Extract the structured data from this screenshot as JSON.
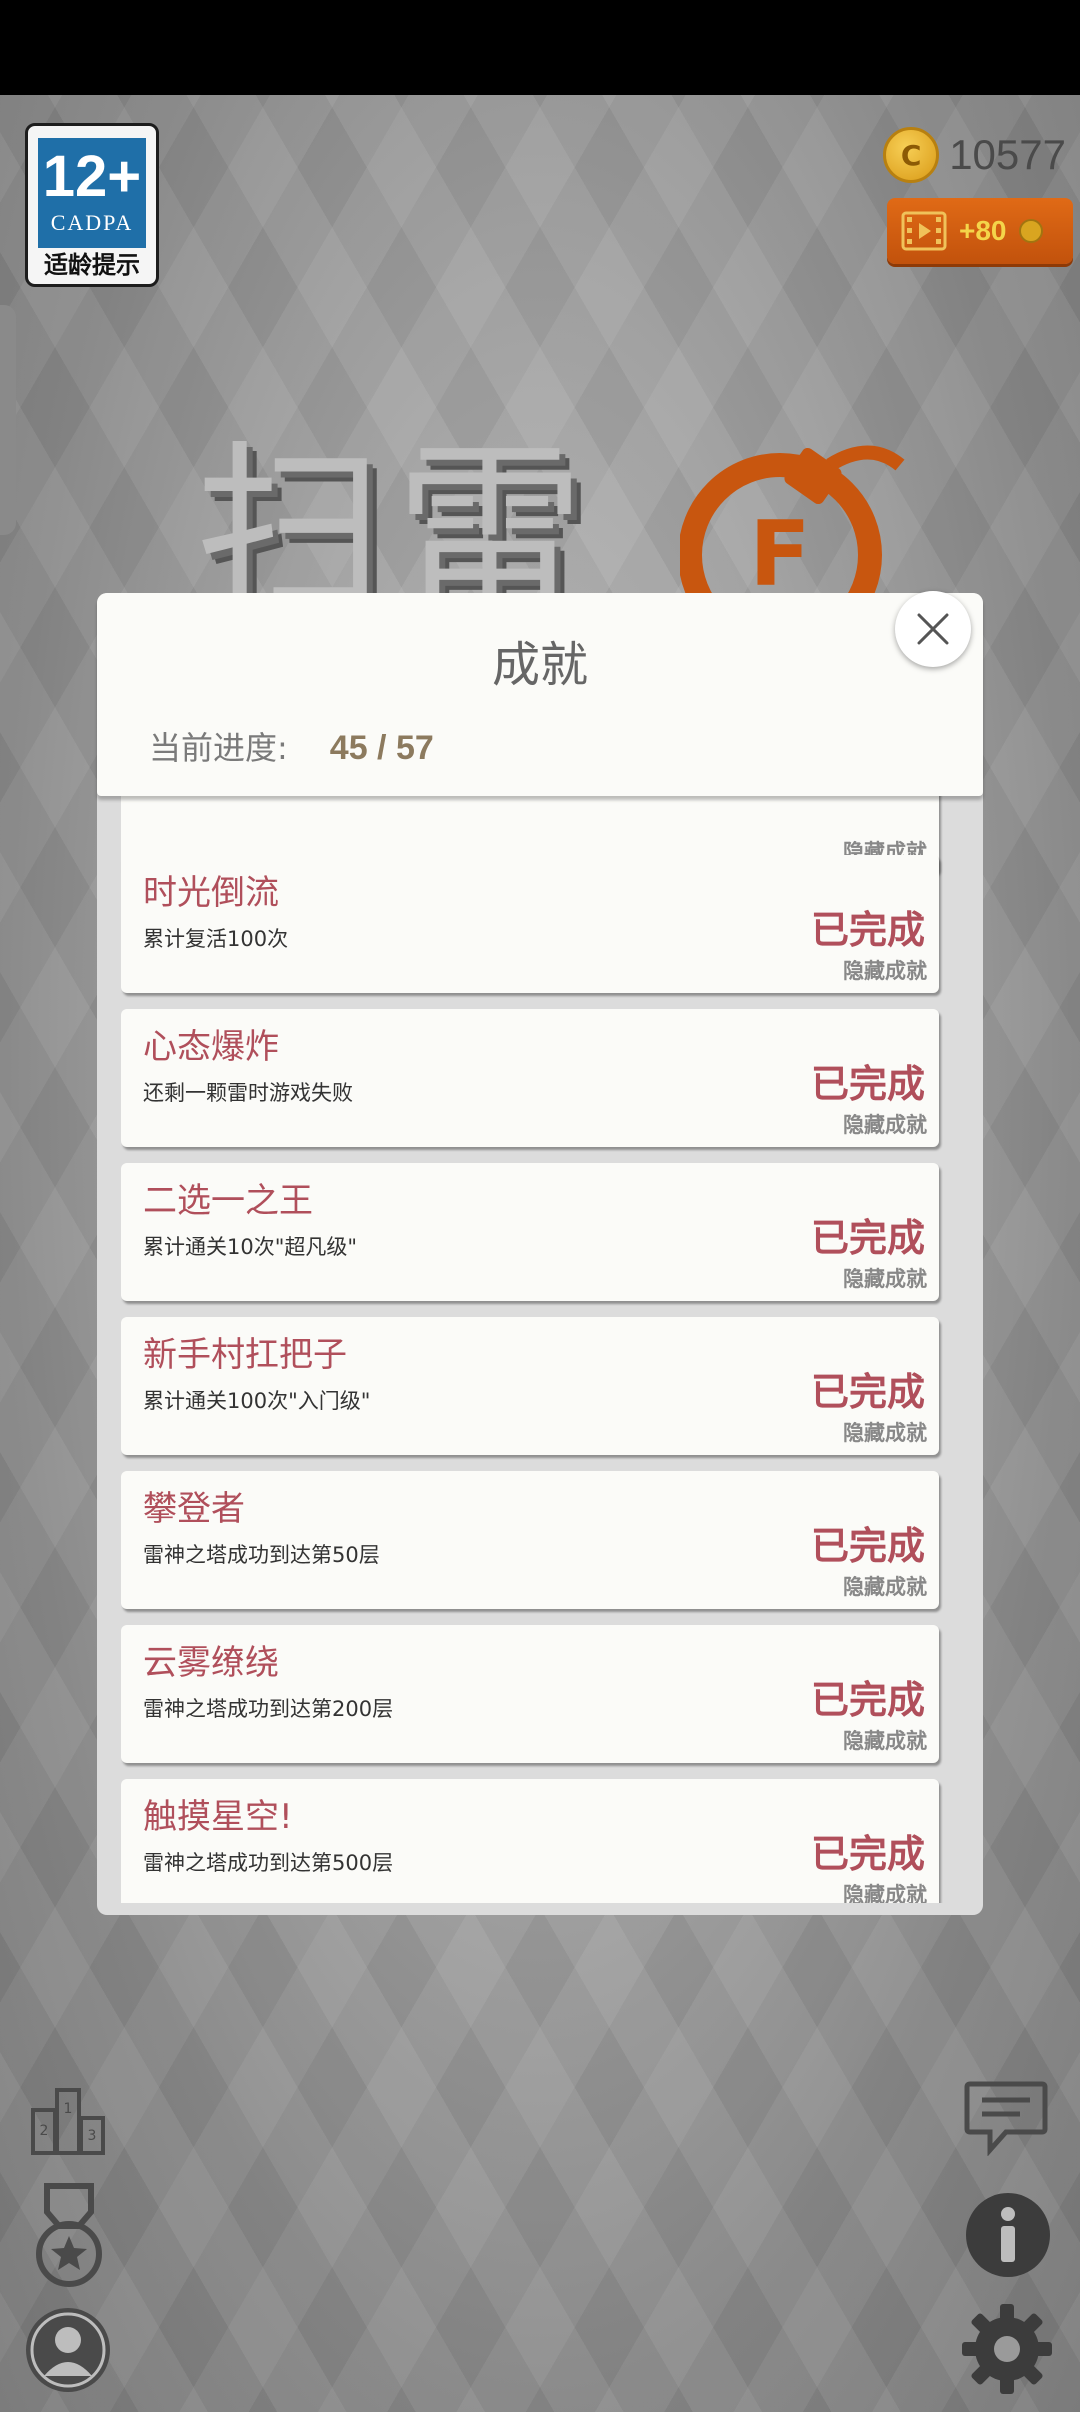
{
  "hud": {
    "age_rating": {
      "number": "12+",
      "org": "CADPA",
      "tip": "适龄提示"
    },
    "coins": "10577",
    "coin_symbol": "C",
    "video_reward": "+80"
  },
  "title": {
    "text": "扫雷",
    "logo_letter": "F"
  },
  "modal": {
    "title": "成就",
    "progress_label": "当前进度:",
    "progress_value": "45 / 57"
  },
  "achievements": [
    {
      "name": "",
      "desc": "",
      "status": "",
      "tag": "隐藏成就"
    },
    {
      "name": "时光倒流",
      "desc": "累计复活100次",
      "status": "已完成",
      "tag": "隐藏成就"
    },
    {
      "name": "心态爆炸",
      "desc": "还剩一颗雷时游戏失败",
      "status": "已完成",
      "tag": "隐藏成就"
    },
    {
      "name": "二选一之王",
      "desc": "累计通关10次\"超凡级\"",
      "status": "已完成",
      "tag": "隐藏成就"
    },
    {
      "name": "新手村扛把子",
      "desc": "累计通关100次\"入门级\"",
      "status": "已完成",
      "tag": "隐藏成就"
    },
    {
      "name": "攀登者",
      "desc": "雷神之塔成功到达第50层",
      "status": "已完成",
      "tag": "隐藏成就"
    },
    {
      "name": "云雾缭绕",
      "desc": "雷神之塔成功到达第200层",
      "status": "已完成",
      "tag": "隐藏成就"
    },
    {
      "name": "触摸星空!",
      "desc": "雷神之塔成功到达第500层",
      "status": "已完成",
      "tag": "隐藏成就"
    }
  ],
  "icons": {
    "leaderboard": "podium-icon",
    "medal": "medal-icon",
    "profile": "profile-icon",
    "feedback": "chat-icon",
    "info": "info-icon",
    "settings": "gear-icon"
  },
  "colors": {
    "achievement_accent": "#b04f5b",
    "reward_button": "#d45f12"
  }
}
